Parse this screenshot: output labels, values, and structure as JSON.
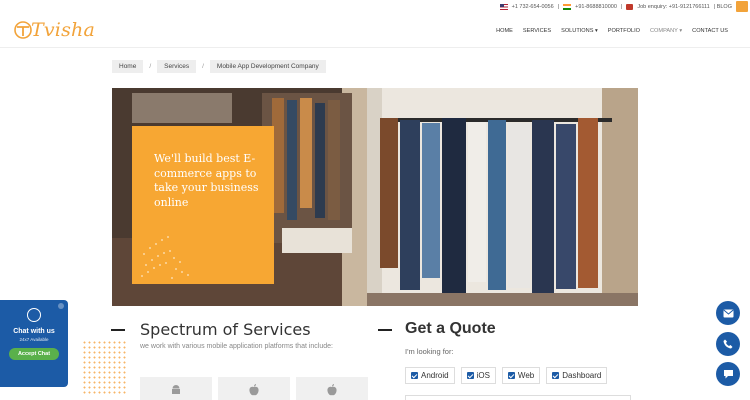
{
  "topbar": {
    "phone_us": "+1 732-654-0056",
    "phone_in": "+91-8688810000",
    "job_enquiry": "Job enquiry: +91-9121766111",
    "blog": "| BLOG"
  },
  "brand": {
    "name": "Tvisha",
    "color": "#f2a33a"
  },
  "nav": {
    "items": [
      {
        "label": "HOME"
      },
      {
        "label": "SERVICES"
      },
      {
        "label": "SOLUTIONS ▾"
      },
      {
        "label": "PORTFOLIO"
      },
      {
        "label": "COMPANY ▾"
      },
      {
        "label": "CONTACT US"
      }
    ]
  },
  "breadcrumb": {
    "items": [
      "Home",
      "Services",
      "Mobile App Development Company"
    ],
    "separator": "/"
  },
  "hero": {
    "headline": "We'll build best E-commerce apps to take your business online",
    "card_color": "#f7a733"
  },
  "chat_widget": {
    "title": "Chat with us",
    "subtitle": "24x7 Available",
    "button": "Accept Chat",
    "color": "#1c5ba6"
  },
  "spectrum": {
    "title": "Spectrum of Services",
    "description": "we work with various mobile application platforms that include:",
    "platforms": [
      "android-icon",
      "apple-icon",
      "apple-icon"
    ]
  },
  "quote": {
    "title": "Get a Quote",
    "label": "I'm looking for:",
    "options": [
      {
        "label": "Android",
        "checked": true
      },
      {
        "label": "iOS",
        "checked": true
      },
      {
        "label": "Web",
        "checked": true
      },
      {
        "label": "Dashboard",
        "checked": true
      }
    ]
  },
  "floating_buttons": [
    "mail-icon",
    "phone-icon",
    "chat-bubble-icon"
  ]
}
